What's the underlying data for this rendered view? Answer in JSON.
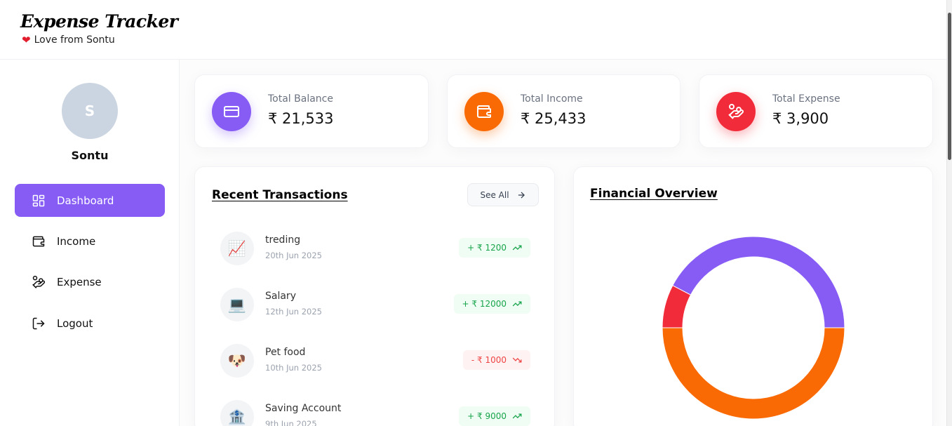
{
  "header": {
    "title": "Expense Tracker",
    "tagline": "Love from Sontu"
  },
  "sidebar": {
    "avatar_initial": "S",
    "user_name": "Sontu",
    "items": [
      {
        "label": "Dashboard",
        "icon": "dashboard-icon",
        "active": true
      },
      {
        "label": "Income",
        "icon": "wallet-icon",
        "active": false
      },
      {
        "label": "Expense",
        "icon": "hand-coins-icon",
        "active": false
      },
      {
        "label": "Logout",
        "icon": "logout-icon",
        "active": false
      }
    ]
  },
  "stats": [
    {
      "label": "Total Balance",
      "value": "₹ 21,533",
      "icon": "credit-card-icon",
      "color": "#875cf5"
    },
    {
      "label": "Total Income",
      "value": "₹ 25,433",
      "icon": "wallet-icon",
      "color": "#fa6a04"
    },
    {
      "label": "Total Expense",
      "value": "₹ 3,900",
      "icon": "hand-coins-icon",
      "color": "#f22b3a"
    }
  ],
  "recent": {
    "title": "Recent Transactions",
    "see_all": "See All",
    "transactions": [
      {
        "icon": "📈",
        "title": "treding",
        "date": "20th Jun 2025",
        "amount": "+ ₹ 1200",
        "type": "income"
      },
      {
        "icon": "💻",
        "title": "Salary",
        "date": "12th Jun 2025",
        "amount": "+ ₹ 12000",
        "type": "income"
      },
      {
        "icon": "🐶",
        "title": "Pet food",
        "date": "10th Jun 2025",
        "amount": "- ₹ 1000",
        "type": "expense"
      },
      {
        "icon": "🏦",
        "title": "Saving Account",
        "date": "9th Jun 2025",
        "amount": "+ ₹ 9000",
        "type": "income"
      }
    ]
  },
  "overview": {
    "title": "Financial Overview"
  },
  "chart_data": {
    "type": "pie",
    "categories": [
      "Total Balance",
      "Total Expense",
      "Total Income"
    ],
    "values": [
      21533,
      3900,
      25433
    ],
    "colors": [
      "#875cf5",
      "#f22b3a",
      "#fa6a04"
    ]
  }
}
